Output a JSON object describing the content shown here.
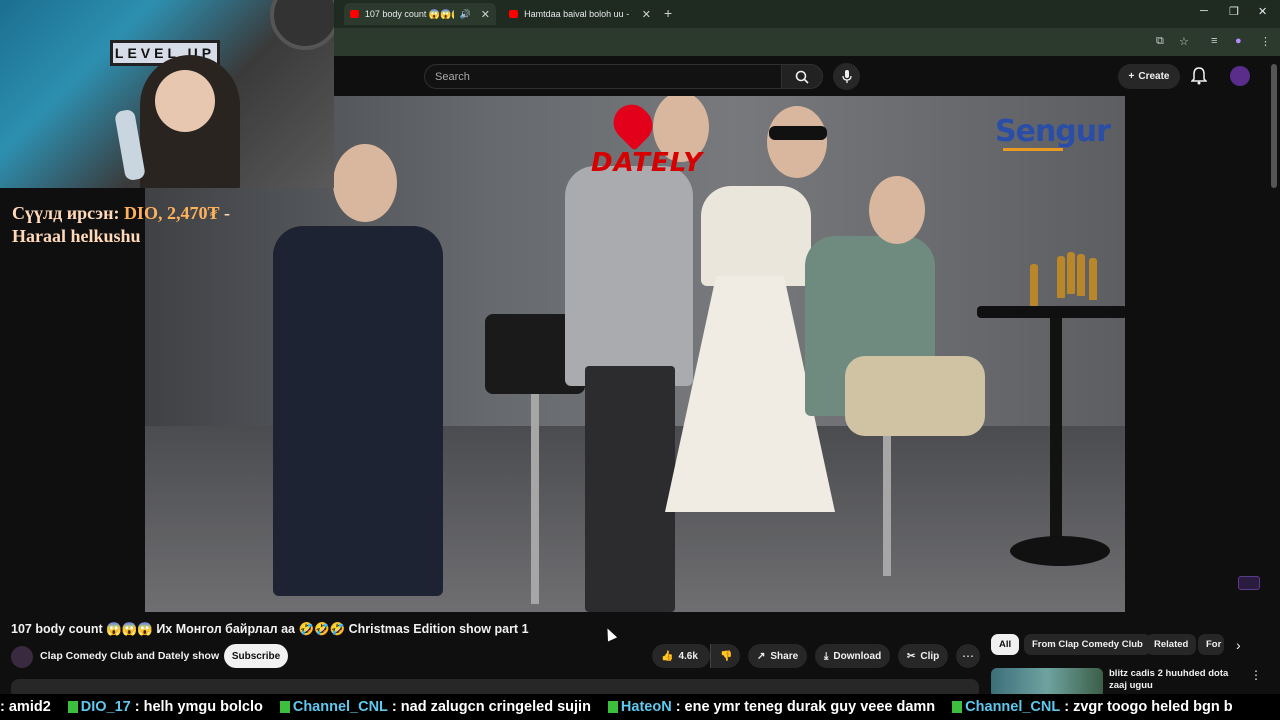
{
  "browser": {
    "tabs": [
      {
        "label": "107 body count 😱😱😱 I"
      },
      {
        "label": "Hamtdaa baival boloh uu - You"
      }
    ],
    "new_tab": "+",
    "minimize": "─",
    "restore": "❐",
    "close": "✕"
  },
  "youtube": {
    "search_placeholder": "Search",
    "create_label": "Create"
  },
  "overlay": {
    "webcam_sign": "LEVEL UP",
    "donation_prefix": "Сүүлд ирсэн: ",
    "donation_highlight": "DIO, 2,470₮",
    "donation_suffix": " - Haraal helkushu"
  },
  "video": {
    "logo_left": "DATELY",
    "logo_right": "Sengur",
    "title": "107 body count 😱😱😱 Их Монгол байрлал аа 🤣🤣🤣 Christmas Edition show part 1",
    "channel": "Clap Comedy Club and Dately show",
    "subscribe": "Subscribe",
    "likes": "4.6k",
    "share": "Share",
    "download": "Download",
    "clip": "Clip"
  },
  "recommendations": {
    "chips": [
      "All",
      "From Clap Comedy Club",
      "Related",
      "For"
    ],
    "first_title": "blitz cadis 2 huuhded dota zaaj uguu"
  },
  "chat": [
    {
      "user": "",
      "text": ": amid2"
    },
    {
      "user": "DIO_17",
      "text": ": helh ymgu bolclo"
    },
    {
      "user": "Channel_CNL",
      "text": ": nad zalugcn cringeled sujin"
    },
    {
      "user": "HateoN",
      "text": ": ene ymr teneg durak guy veee damn"
    },
    {
      "user": "Channel_CNL",
      "text": ": zvgr toogo heled bgn b"
    }
  ],
  "colors": {
    "background": "#0f0f0f",
    "accent_red": "#ff0000",
    "chat_username": "#5fc8ef",
    "donation": "#ffb25a"
  }
}
